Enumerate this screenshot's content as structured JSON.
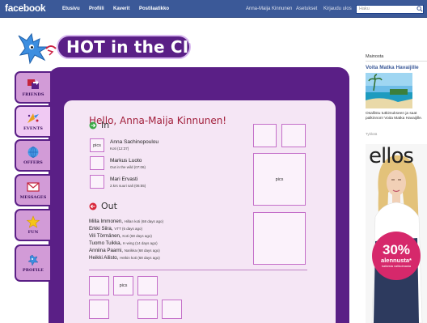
{
  "topbar": {
    "logo": "facebook",
    "nav": [
      "Etusivu",
      "Profiili",
      "Kaverit",
      "Postilaatikko"
    ],
    "user": "Anna-Maija Kinnunen",
    "settings": "Asetukset",
    "logout": "Kirjaudu ulos",
    "search_placeholder": "Haku"
  },
  "app": {
    "title": "HOT in the CITY",
    "greeting": "Hello, Anna-Maija Kinnunen!",
    "tabs": [
      {
        "label": "FRIENDS",
        "icon": "friends-icon"
      },
      {
        "label": "EVENTS",
        "icon": "events-icon"
      },
      {
        "label": "OFFERS",
        "icon": "offers-icon"
      },
      {
        "label": "MESSAGES",
        "icon": "messages-icon"
      },
      {
        "label": "FUN",
        "icon": "fun-star-icon"
      },
      {
        "label": "PROFILE",
        "icon": "profile-icon"
      }
    ],
    "in_section": {
      "title": "In",
      "friends": [
        {
          "pic": "pics",
          "name": "Anna Sachinopoulou",
          "detail": "Koti (12:37)"
        },
        {
          "pic": "",
          "name": "Markus Luoto",
          "detail": "Out in the wild (07:06)"
        },
        {
          "pic": "",
          "name": "Mari Ervasti",
          "detail": "2.krs suuri sali (06:55)"
        }
      ]
    },
    "out_section": {
      "title": "Out",
      "friends": [
        {
          "name": "Milla Immonen,",
          "detail": "Hillan koti (68 days ago)"
        },
        {
          "name": "Erkki Siira,",
          "detail": "VTT (6 days ago)"
        },
        {
          "name": "Vili Törmänen,",
          "detail": "Koti (68 days ago)"
        },
        {
          "name": "Tuomo Tuikka,",
          "detail": "K-wing (14 days ago)"
        },
        {
          "name": "Anniina Paarni,",
          "detail": "Narikka (68 days ago)"
        },
        {
          "name": "Heikki Ailisto,",
          "detail": "Heikin koti (68 days ago)"
        }
      ]
    },
    "gallery_right_label": "pics",
    "gallery_bottom_label": "pics"
  },
  "sidebar": {
    "ads_heading": "Mainosta",
    "ad_title": "Voita Matka Havaijille",
    "ad_body": "Osallistu tutkimukseen ja saat palkinnon! Voita Matka Havaijille.",
    "ad_like": "Tykkää",
    "ellos_brand": "ellos",
    "ellos_percent": "30%",
    "ellos_word": "alennusta*",
    "ellos_small": "kaikesta valikoimasta"
  },
  "colors": {
    "facebook_blue": "#3b5998",
    "app_purple": "#5a1f86",
    "panel_pink": "#f5e6f5",
    "greeting_red": "#a11e3a",
    "ellos_pink": "#d6286b"
  }
}
